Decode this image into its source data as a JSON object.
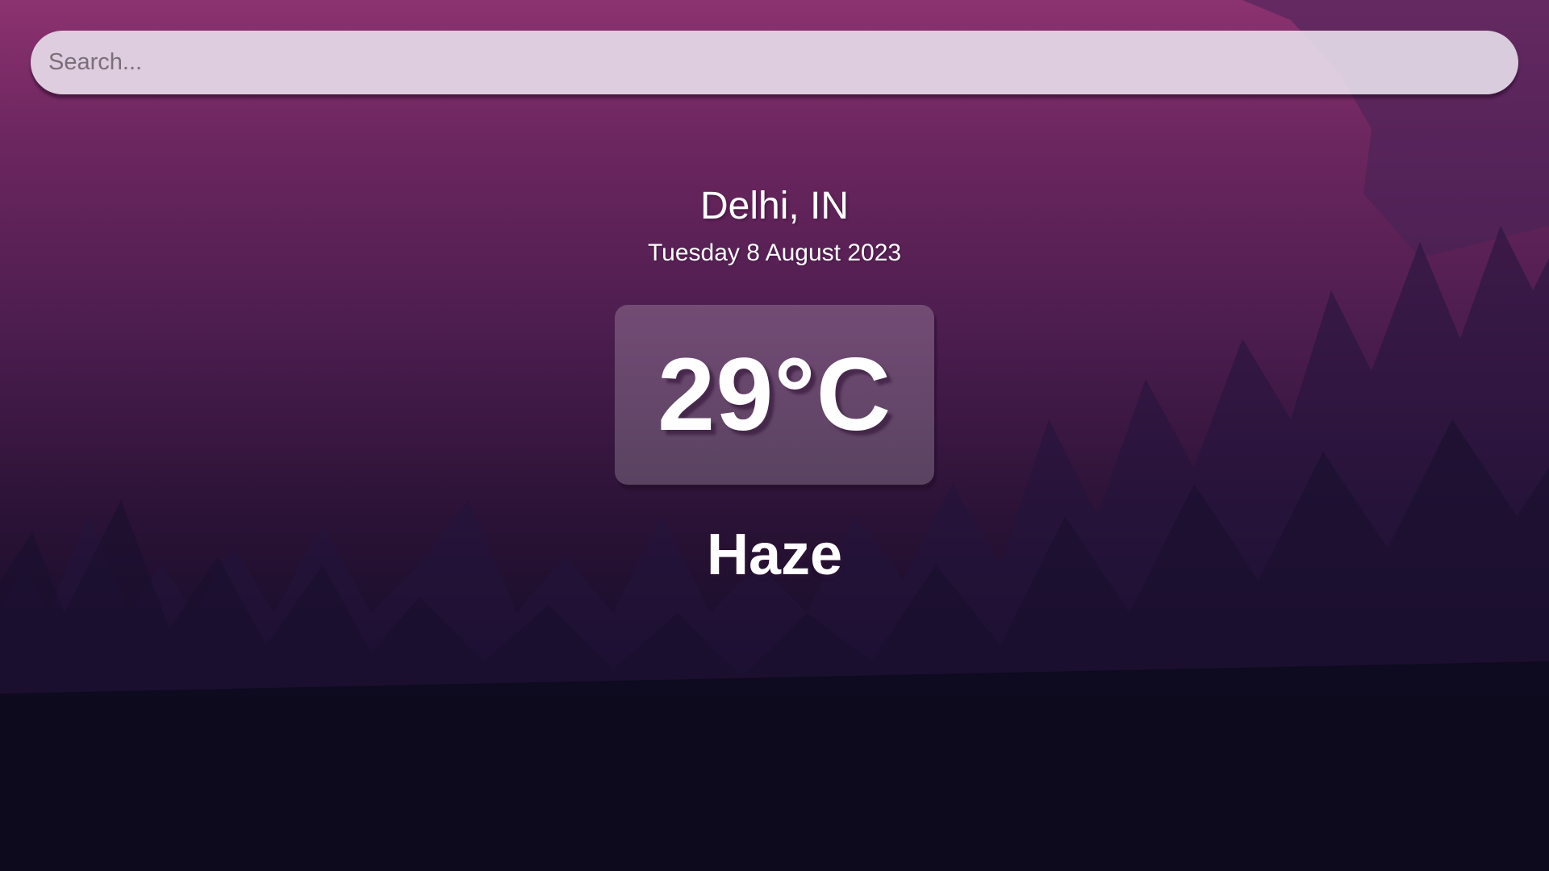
{
  "search": {
    "placeholder": "Search...",
    "value": ""
  },
  "weather": {
    "location": "Delhi, IN",
    "date": "Tuesday 8 August 2023",
    "temperature": "29°C",
    "condition": "Haze"
  },
  "colors": {
    "sky_top": "#8c3270",
    "sky_mid": "#4c1d4f",
    "ground": "#0a0818",
    "search_bg": "#eee8f2",
    "text": "#ffffff"
  }
}
